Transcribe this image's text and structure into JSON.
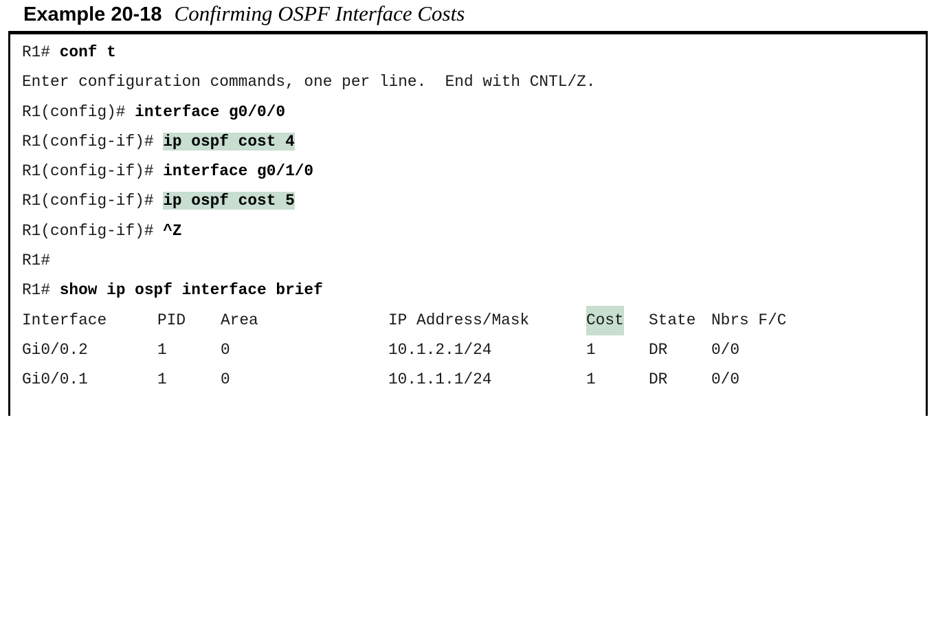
{
  "caption": {
    "label": "Example 20-18",
    "title": "Confirming OSPF Interface Costs"
  },
  "lines": [
    {
      "prompt": "R1# ",
      "command": "conf t"
    },
    {
      "output": "Enter configuration commands, one per line.  End with CNTL/Z."
    },
    {
      "prompt": "R1(config)# ",
      "command": "interface g0/0/0"
    },
    {
      "prompt": "R1(config-if)# ",
      "command": "ip ospf cost 4",
      "highlighted": true
    },
    {
      "prompt": "R1(config-if)# ",
      "command": "interface g0/1/0"
    },
    {
      "prompt": "R1(config-if)# ",
      "command": "ip ospf cost 5",
      "highlighted": true
    },
    {
      "prompt": "R1(config-if)# ",
      "command": "^Z"
    },
    {
      "prompt": "R1#"
    },
    {
      "prompt": "R1# ",
      "command": "show ip ospf interface brief"
    }
  ],
  "table": {
    "headers": {
      "interface": "Interface",
      "pid": "PID",
      "area": "Area",
      "ip": "IP Address/Mask",
      "cost": "Cost",
      "state": "State",
      "nbrs": "Nbrs F/C"
    },
    "rows": [
      {
        "interface": "Gi0/0.2",
        "pid": "1",
        "area": "0",
        "ip": "10.1.2.1/24",
        "cost": "1",
        "state": "DR",
        "nbrs": "0/0"
      },
      {
        "interface": "Gi0/0.1",
        "pid": "1",
        "area": "0",
        "ip": "10.1.1.1/24",
        "cost": "1",
        "state": "DR",
        "nbrs": "0/0"
      }
    ]
  },
  "colors": {
    "highlight": "#c7ded0",
    "border": "#000000",
    "text": "#1a1a1a"
  }
}
